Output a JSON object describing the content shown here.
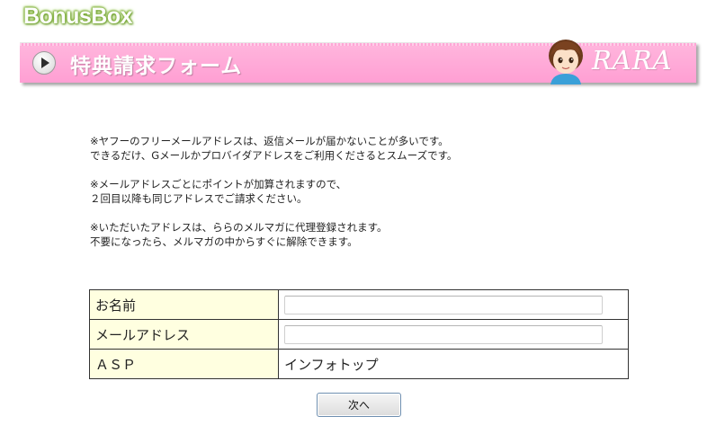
{
  "logo": {
    "text": "BonusBox"
  },
  "banner": {
    "title": "特典請求フォーム",
    "brand": "RARA"
  },
  "notice": {
    "paragraphs": [
      [
        "※ヤフーのフリーメールアドレスは、返信メールが届かないことが多いです。",
        "できるだけ、Gメールかプロバイダアドレスをご利用くださるとスムーズです。"
      ],
      [
        "※メールアドレスごとにポイントが加算されますので、",
        "２回目以降も同じアドレスでご請求ください。"
      ],
      [
        "※いただいたアドレスは、ららのメルマガに代理登録されます。",
        "不要になったら、メルマガの中からすぐに解除できます。"
      ]
    ]
  },
  "form": {
    "name_label": "お名前",
    "name_value": "",
    "email_label": "メールアドレス",
    "email_value": "",
    "asp_label": "ＡＳＰ",
    "asp_value": "インフォトップ"
  },
  "next_button": {
    "label": "次へ"
  },
  "colors": {
    "banner": "#ff9fd3",
    "label_cell": "#ffffe0",
    "logo_glow": "#7fae3a"
  }
}
